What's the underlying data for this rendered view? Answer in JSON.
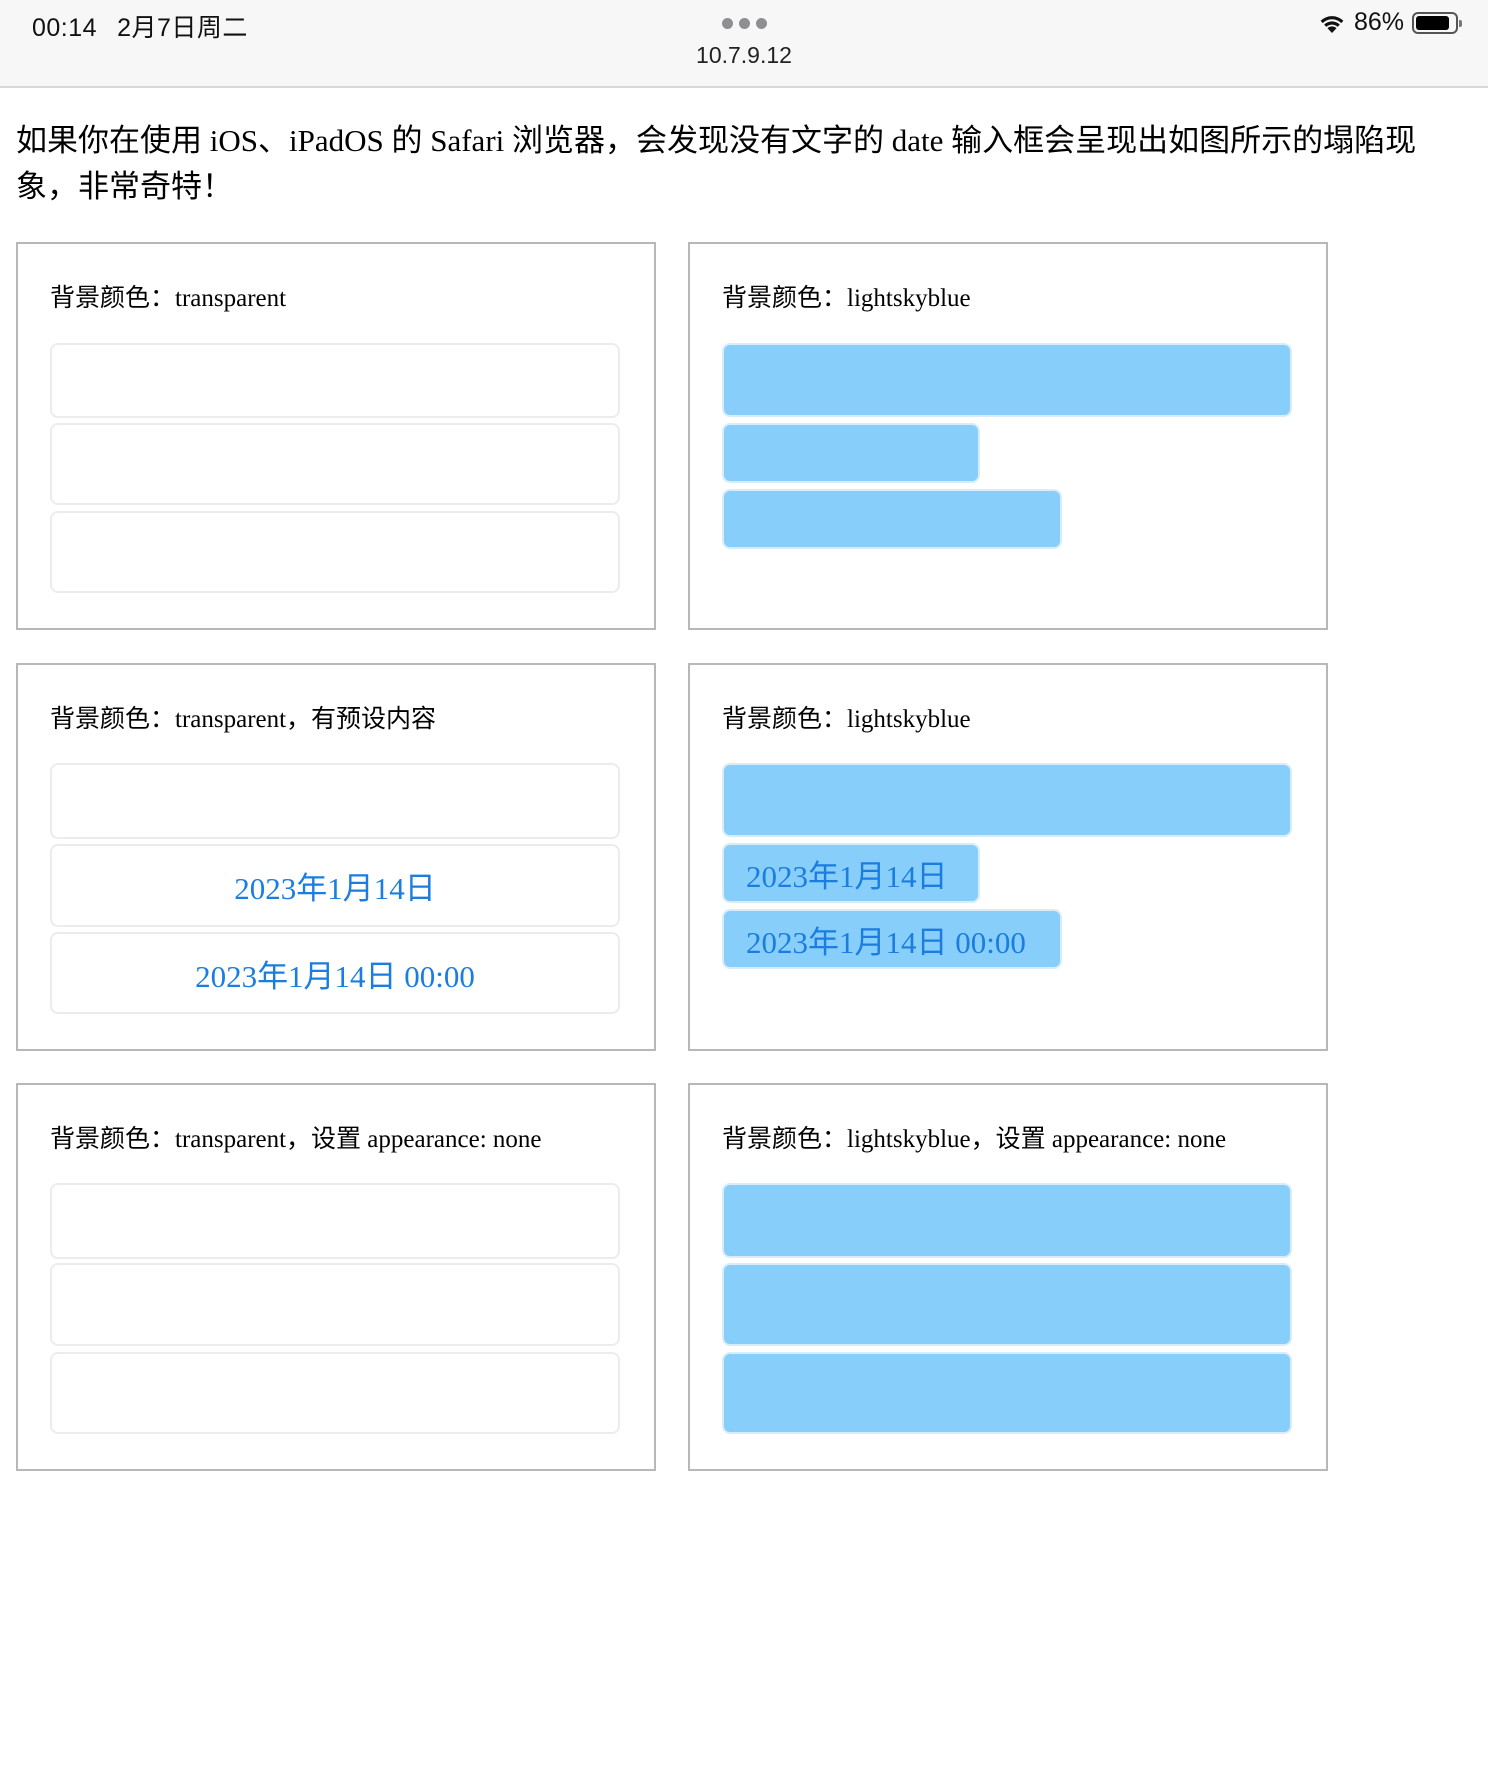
{
  "status_bar": {
    "time": "00:14",
    "date": "2月7日周二",
    "url": "10.7.9.12",
    "battery": "86%",
    "battery_level": 0.86
  },
  "intro": "如果你在使用 iOS、iPadOS 的 Safari 浏览器，会发现没有文字的 date 输入框会呈现出如图所示的塌陷现象，非常奇特！",
  "colors": {
    "blue_bg": "#87cefa",
    "date_text": "#1b7ddf",
    "border": "#b8b8b8"
  },
  "cards": [
    {
      "title": "背景颜色：transparent",
      "fields": [
        {
          "value": ""
        },
        {
          "value": ""
        },
        {
          "value": ""
        }
      ]
    },
    {
      "title": "背景颜色：lightskyblue",
      "fields": [
        {
          "value": ""
        },
        {
          "value": ""
        },
        {
          "value": ""
        }
      ]
    },
    {
      "title": "背景颜色：transparent，有预设内容",
      "fields": [
        {
          "value": ""
        },
        {
          "value": "2023年1月14日"
        },
        {
          "value": "2023年1月14日 00:00"
        }
      ]
    },
    {
      "title": "背景颜色：lightskyblue",
      "fields": [
        {
          "value": ""
        },
        {
          "value": "2023年1月14日"
        },
        {
          "value": "2023年1月14日 00:00"
        }
      ]
    },
    {
      "title": "背景颜色：transparent，设置 appearance: none",
      "fields": [
        {
          "value": ""
        },
        {
          "value": ""
        },
        {
          "value": ""
        }
      ]
    },
    {
      "title": "背景颜色：lightskyblue，设置 appearance: none",
      "fields": [
        {
          "value": ""
        },
        {
          "value": ""
        },
        {
          "value": ""
        }
      ]
    }
  ]
}
